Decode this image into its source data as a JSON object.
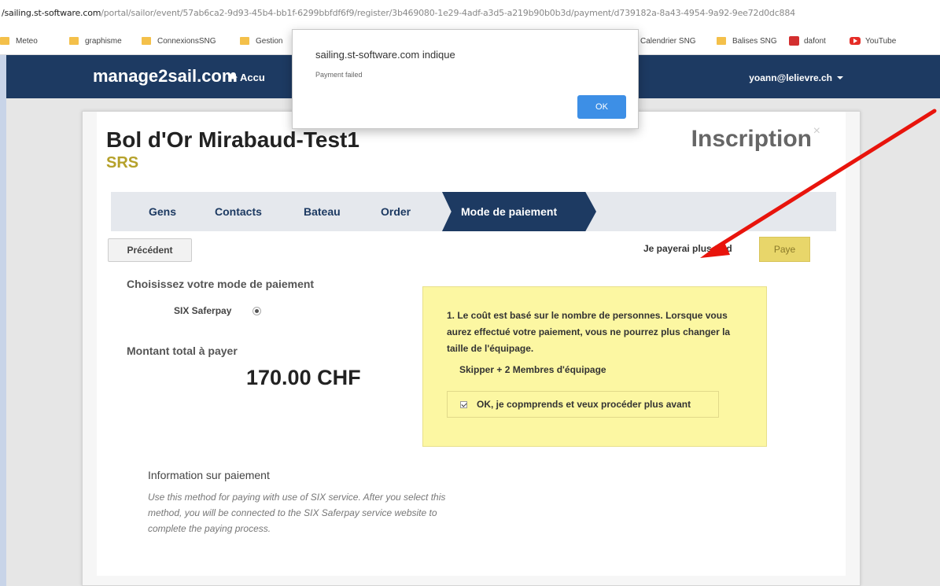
{
  "browser": {
    "url_host": "/sailing.st-software.com",
    "url_path": "/portal/sailor/event/57ab6ca2-9d93-45b4-bb1f-6299bbfdf6f9/register/3b469080-1e29-4adf-a3d5-a219b90b0b3d/payment/d739182a-8a43-4954-9a92-9ee72d0dc884",
    "bookmarks": [
      "Meteo",
      "graphisme",
      "ConnexionsSNG",
      "Gestion",
      "Calendrier SNG",
      "Balises SNG",
      "dafont",
      "YouTube"
    ]
  },
  "navbar": {
    "brand": "manage2sail.com",
    "home_label": "Accu",
    "user_email": "yoann@lelievre.ch"
  },
  "alert": {
    "title": "sailing.st-software.com indique",
    "message": "Payment failed",
    "ok_label": "OK"
  },
  "page": {
    "event_title": "Bol d'Or Mirabaud-Test1",
    "class_label": "SRS",
    "heading": "Inscription",
    "close_symbol": "×"
  },
  "steps": [
    "Gens",
    "Contacts",
    "Bateau",
    "Order",
    "Mode de paiement"
  ],
  "actions": {
    "previous_label": "Précédent",
    "pay_later_label": "Je payerai plus tard",
    "pay_label": "Paye"
  },
  "payment": {
    "method_label": "Choisissez votre mode de paiement",
    "option_label": "SIX Saferpay",
    "amount_label": "Montant total à payer",
    "amount_value": "170.00 CHF"
  },
  "notice": {
    "text": "1. Le coût est basé sur le nombre de personnes. Lorsque vous aurez effectué votre paiement, vous ne pourrez plus changer la taille de l'équipage.",
    "crew": "Skipper + 2 Membres d'équipage",
    "confirm_label": "OK, je copmprends et veux procéder plus avant"
  },
  "info": {
    "heading": "Information sur paiement",
    "text": "Use this method for paying with use of SIX service. After you select this method, you will be connected to the SIX Saferpay service website to complete the paying process."
  },
  "annotation": {
    "arrow_color": "#e8140c"
  }
}
